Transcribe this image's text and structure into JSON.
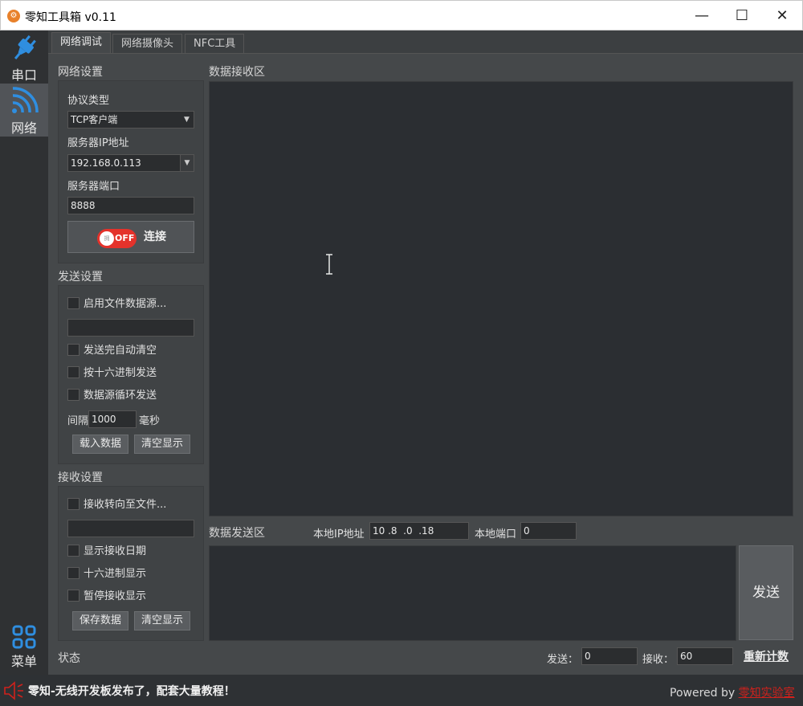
{
  "app": {
    "title": "零知工具箱 v0.11"
  },
  "window": {
    "minimize": "—",
    "maximize": "☐",
    "close": "✕"
  },
  "nav": {
    "serial": "串口",
    "network": "网络",
    "menu": "菜单"
  },
  "tabs": [
    "网络调试",
    "网络摄像头",
    "NFC工具"
  ],
  "network_settings": {
    "title": "网络设置",
    "protocol_label": "协议类型",
    "protocol_value": "TCP客户端",
    "server_ip_label": "服务器IP地址",
    "server_ip_value": "192.168.0.113",
    "server_port_label": "服务器端口",
    "server_port_value": "8888",
    "toggle_state": "OFF",
    "toggle_knob": "拥",
    "connect_label": "连接"
  },
  "send_settings": {
    "title": "发送设置",
    "file_source": "启用文件数据源...",
    "auto_clear": "发送完自动清空",
    "hex_send": "按十六进制发送",
    "loop_send": "数据源循环发送",
    "interval_label": "间隔",
    "interval_value": "1000",
    "interval_unit": "毫秒",
    "load_button": "载入数据",
    "clear_button": "清空显示"
  },
  "recv_settings": {
    "title": "接收设置",
    "redirect": "接收转向至文件...",
    "show_date": "显示接收日期",
    "hex_display": "十六进制显示",
    "pause": "暂停接收显示",
    "save_button": "保存数据",
    "clear_button": "清空显示"
  },
  "receive_area": {
    "title": "数据接收区"
  },
  "send_area": {
    "title": "数据发送区",
    "local_ip_label": "本地IP地址",
    "local_ip_value": "10 .8  .0  .18",
    "local_port_label": "本地端口",
    "local_port_value": "0",
    "send_button": "发送"
  },
  "status": {
    "label": "状态",
    "sent_label": "发送：",
    "sent_value": "0",
    "recv_label": "接收：",
    "recv_value": "60",
    "reset_label": "重新计数"
  },
  "footer": {
    "news": "零知-无线开发板发布了，配套大量教程！",
    "powered_prefix": "Powered by ",
    "powered_link": "零知实验室"
  },
  "colors": {
    "accent_blue": "#2f8ee0",
    "toggle_red": "#e4322b",
    "link_red": "#d0211c"
  }
}
